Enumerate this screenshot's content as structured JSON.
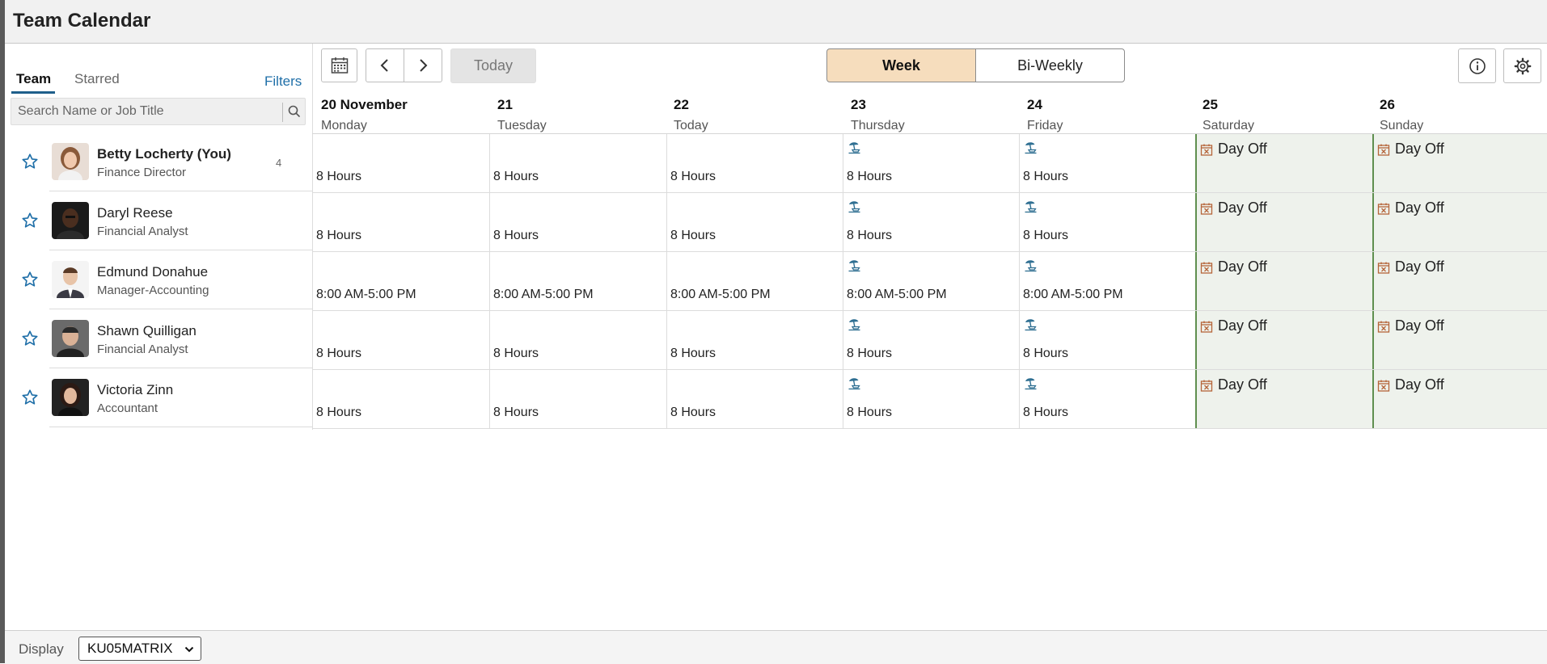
{
  "header": {
    "title": "Team Calendar"
  },
  "tabs": [
    {
      "label": "Team",
      "active": true
    },
    {
      "label": "Starred",
      "active": false
    }
  ],
  "filters_label": "Filters",
  "search": {
    "placeholder": "Search Name or Job Title",
    "value": ""
  },
  "toolbar": {
    "today_label": "Today",
    "view_week": "Week",
    "view_biweekly": "Bi-Weekly",
    "active_view": "Week",
    "icons": [
      "calendar-icon",
      "chevron-left-icon",
      "chevron-right-icon",
      "info-icon",
      "gear-icon"
    ]
  },
  "days": [
    {
      "num": "20 November",
      "name": "Monday",
      "weekend": false
    },
    {
      "num": "21",
      "name": "Tuesday",
      "weekend": false
    },
    {
      "num": "22",
      "name": "Today",
      "weekend": false
    },
    {
      "num": "23",
      "name": "Thursday",
      "weekend": false
    },
    {
      "num": "24",
      "name": "Friday",
      "weekend": false
    },
    {
      "num": "25",
      "name": "Saturday",
      "weekend": true
    },
    {
      "num": "26",
      "name": "Sunday",
      "weekend": true
    }
  ],
  "people": [
    {
      "name": "Betty Locherty (You)",
      "title": "Finance Director",
      "count": "4",
      "bold": true,
      "cells": [
        "8 Hours",
        "8 Hours",
        "8 Hours",
        "8 Hours",
        "8 Hours",
        "Day Off",
        "Day Off"
      ]
    },
    {
      "name": "Daryl Reese",
      "title": "Financial Analyst",
      "count": "",
      "bold": false,
      "cells": [
        "8 Hours",
        "8 Hours",
        "8 Hours",
        "8 Hours",
        "8 Hours",
        "Day Off",
        "Day Off"
      ]
    },
    {
      "name": "Edmund Donahue",
      "title": "Manager-Accounting",
      "count": "",
      "bold": false,
      "cells": [
        "8:00 AM-5:00 PM",
        "8:00 AM-5:00 PM",
        "8:00 AM-5:00 PM",
        "8:00 AM-5:00 PM",
        "8:00 AM-5:00 PM",
        "Day Off",
        "Day Off"
      ]
    },
    {
      "name": "Shawn Quilligan",
      "title": "Financial Analyst",
      "count": "",
      "bold": false,
      "cells": [
        "8 Hours",
        "8 Hours",
        "8 Hours",
        "8 Hours",
        "8 Hours",
        "Day Off",
        "Day Off"
      ]
    },
    {
      "name": "Victoria Zinn",
      "title": "Accountant",
      "count": "",
      "bold": false,
      "cells": [
        "8 Hours",
        "8 Hours",
        "8 Hours",
        "8 Hours",
        "8 Hours",
        "Day Off",
        "Day Off"
      ]
    }
  ],
  "vacation_icon_days": [
    3,
    4
  ],
  "footer": {
    "display_label": "Display",
    "display_value": "KU05MATRIX"
  },
  "colors": {
    "accent": "#1f6fa8",
    "week_active": "#f6ddbd",
    "weekend": "#eef2ec",
    "weekend_border": "#5f8f4f",
    "dayoff_icon": "#b5653a"
  }
}
